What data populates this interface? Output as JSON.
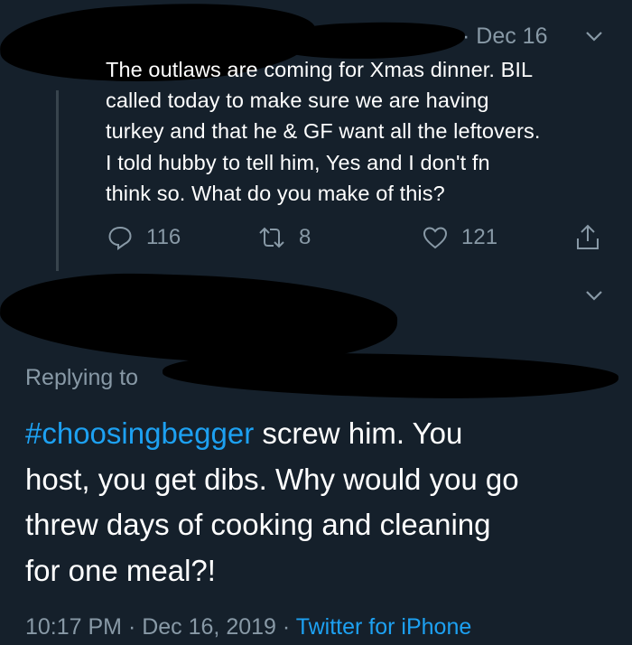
{
  "quoted_tweet": {
    "date": "· Dec 16",
    "text": "The outlaws are coming for Xmas dinner. BIL\ncalled today to make sure we are having\nturkey and that he & GF want all the leftovers.\nI told hubby to tell him, Yes and I don't fn\nthink so. What do you make of this?",
    "reply_count": "116",
    "retweet_count": "8",
    "like_count": "121"
  },
  "reply": {
    "replying_to_label": "Replying to",
    "hashtag": "#choosingbegger",
    "text": " screw him. You\nhost, you get dibs. Why would you go\nthrew days of cooking and cleaning\nfor one meal?!",
    "timestamp": "10:17 PM · Dec 16, 2019 · ",
    "source": "Twitter for iPhone"
  },
  "icons": {
    "reply": "reply-bubble-icon",
    "retweet": "retweet-icon",
    "like": "heart-icon",
    "share": "share-icon",
    "menu": "chevron-down-icon"
  },
  "colors": {
    "background": "#15202b",
    "muted": "#8899a6",
    "link": "#1da1f2"
  }
}
